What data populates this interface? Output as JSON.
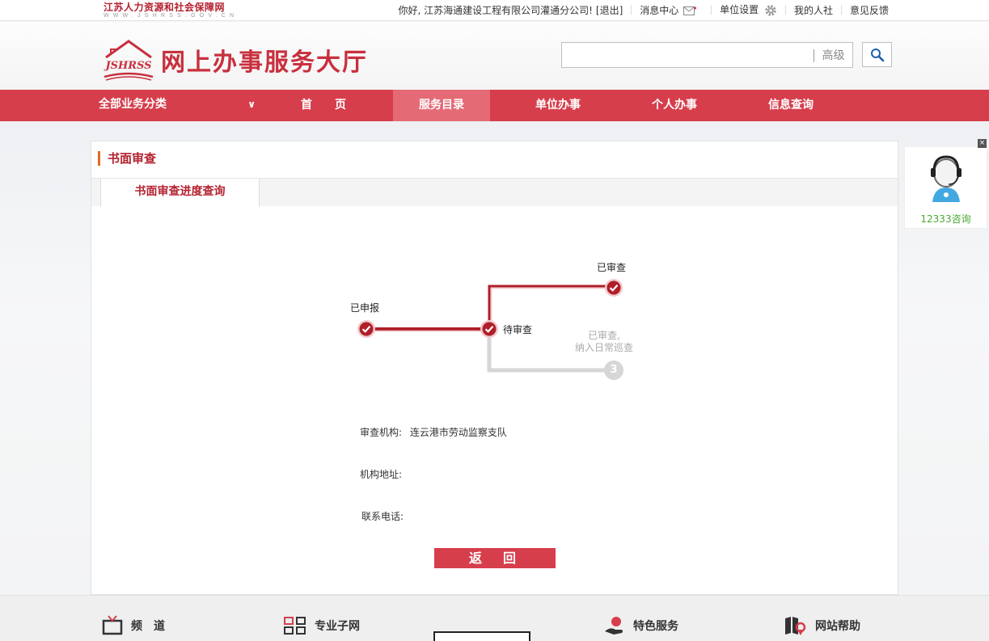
{
  "topbar": {
    "brand_cn": "江苏人力资源和社会保障网",
    "brand_en": "WWW.JSHRSS.GOV.CN",
    "greeting": "你好, 江苏海通建设工程有限公司灌通分公司!",
    "logout": "[退出]",
    "messages": "消息中心",
    "unit_settings": "单位设置",
    "my_hrss": "我的人社",
    "feedback": "意见反馈"
  },
  "header": {
    "logo_mark": "JSHRSS",
    "title": "网上办事服务大厅",
    "search": {
      "value": "",
      "placeholder": ""
    },
    "advanced": "高级"
  },
  "nav": {
    "all_categories": "全部业务分类",
    "items": [
      {
        "label": "首　　页",
        "active": false
      },
      {
        "label": "服务目录",
        "active": true
      },
      {
        "label": "单位办事",
        "active": false
      },
      {
        "label": "个人办事",
        "active": false
      },
      {
        "label": "信息查询",
        "active": false
      }
    ]
  },
  "panel": {
    "title": "书面审查",
    "tab": "书面审查进度查询"
  },
  "progress": {
    "steps": [
      {
        "label": "已申报",
        "done": true
      },
      {
        "label": "待审查",
        "done": true
      },
      {
        "label": "已审查",
        "done": true
      },
      {
        "label_line1": "已审查,",
        "label_line2": "纳入日常巡查",
        "number": "3",
        "done": false
      }
    ]
  },
  "info": {
    "agency_label": "审查机构:",
    "agency_value": "连云港市劳动监察支队",
    "address_label": "机构地址:",
    "address_value": "",
    "phone_label": "联系电话:",
    "phone_value": ""
  },
  "back_button": "返回",
  "consult": {
    "label": "12333咨询",
    "close": "×"
  },
  "footer": {
    "items": [
      {
        "label": "频　道"
      },
      {
        "label": "专业子网"
      },
      {
        "label": "特色服务"
      },
      {
        "label": "网站帮助"
      }
    ]
  },
  "colors": {
    "brand_red": "#d63e4c",
    "dark_red": "#b42230",
    "accent_orange": "#e26a1e",
    "consult_green": "#4aa832"
  }
}
